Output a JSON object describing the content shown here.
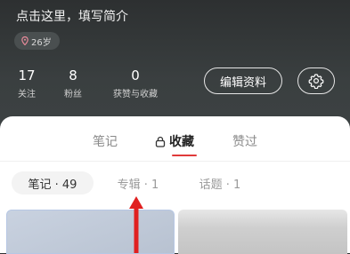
{
  "profile": {
    "intro": "点击这里，填写简介",
    "age": "26岁",
    "stats": [
      {
        "num": "17",
        "label": "关注"
      },
      {
        "num": "8",
        "label": "粉丝"
      },
      {
        "num": "0",
        "label": "获赞与收藏"
      }
    ],
    "edit_label": "编辑资料"
  },
  "tabs": [
    {
      "label": "笔记",
      "active": false
    },
    {
      "label": "收藏",
      "active": true,
      "icon": "lock-icon"
    },
    {
      "label": "赞过",
      "active": false
    }
  ],
  "chips": [
    {
      "label": "笔记 · 49",
      "active": true
    },
    {
      "label": "专辑 · 1",
      "active": false
    },
    {
      "label": "话题 · 1",
      "active": false
    }
  ],
  "colors": {
    "accent": "#e03a3a",
    "arrow": "#e02020"
  }
}
